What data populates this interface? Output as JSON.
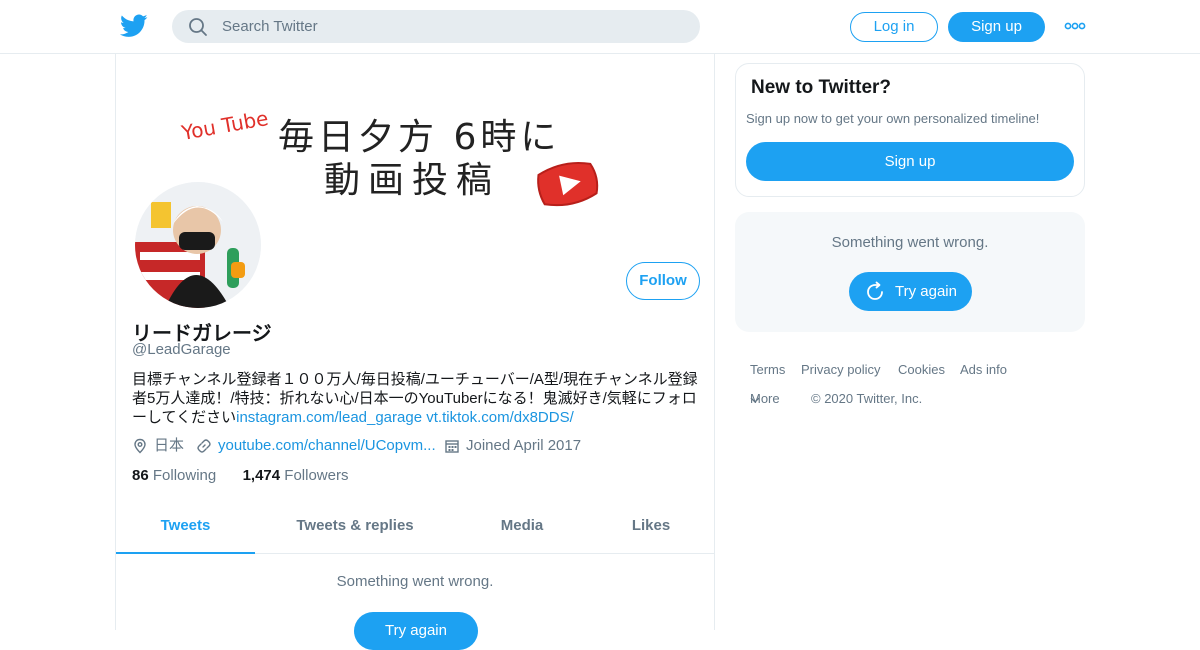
{
  "nav": {
    "search_placeholder": "Search Twitter",
    "login_label": "Log in",
    "signup_label": "Sign up",
    "brand_color": "#1da1f2"
  },
  "banner": {
    "youtube_text": "You Tube",
    "line1": "毎日夕方 6時に",
    "line2": "動画投稿"
  },
  "profile": {
    "display_name": "リードガレージ",
    "handle": "@LeadGarage",
    "follow_label": "Follow",
    "bio_text": "目標チャンネル登録者１００万人/毎日投稿/ユーチューバー/A型/現在チャンネル登録者5万人達成！/特技：折れない心/日本一のYouTuberになる！鬼滅好き/気軽にフォローしてください",
    "bio_link1": "instagram.com/lead_garage",
    "bio_link2": "vt.tiktok.com/dx8DDS/",
    "location": "日本",
    "website": "youtube.com/channel/UCopvm...",
    "joined": "Joined April 2017",
    "following_count": "86",
    "following_label": "Following",
    "followers_count": "1,474",
    "followers_label": "Followers"
  },
  "tabs": [
    {
      "label": "Tweets",
      "active": true
    },
    {
      "label": "Tweets & replies",
      "active": false
    },
    {
      "label": "Media",
      "active": false
    },
    {
      "label": "Likes",
      "active": false
    }
  ],
  "timeline": {
    "error_text": "Something went wrong.",
    "retry_label": "Try again"
  },
  "sidebar": {
    "new_title": "New to Twitter?",
    "new_text": "Sign up now to get your own personalized timeline!",
    "signup_label": "Sign up",
    "error_text": "Something went wrong.",
    "retry_label": "Try again"
  },
  "footer": {
    "terms": "Terms",
    "privacy": "Privacy policy",
    "cookies": "Cookies",
    "ads": "Ads info",
    "more": "More",
    "copyright": "© 2020 Twitter, Inc."
  }
}
